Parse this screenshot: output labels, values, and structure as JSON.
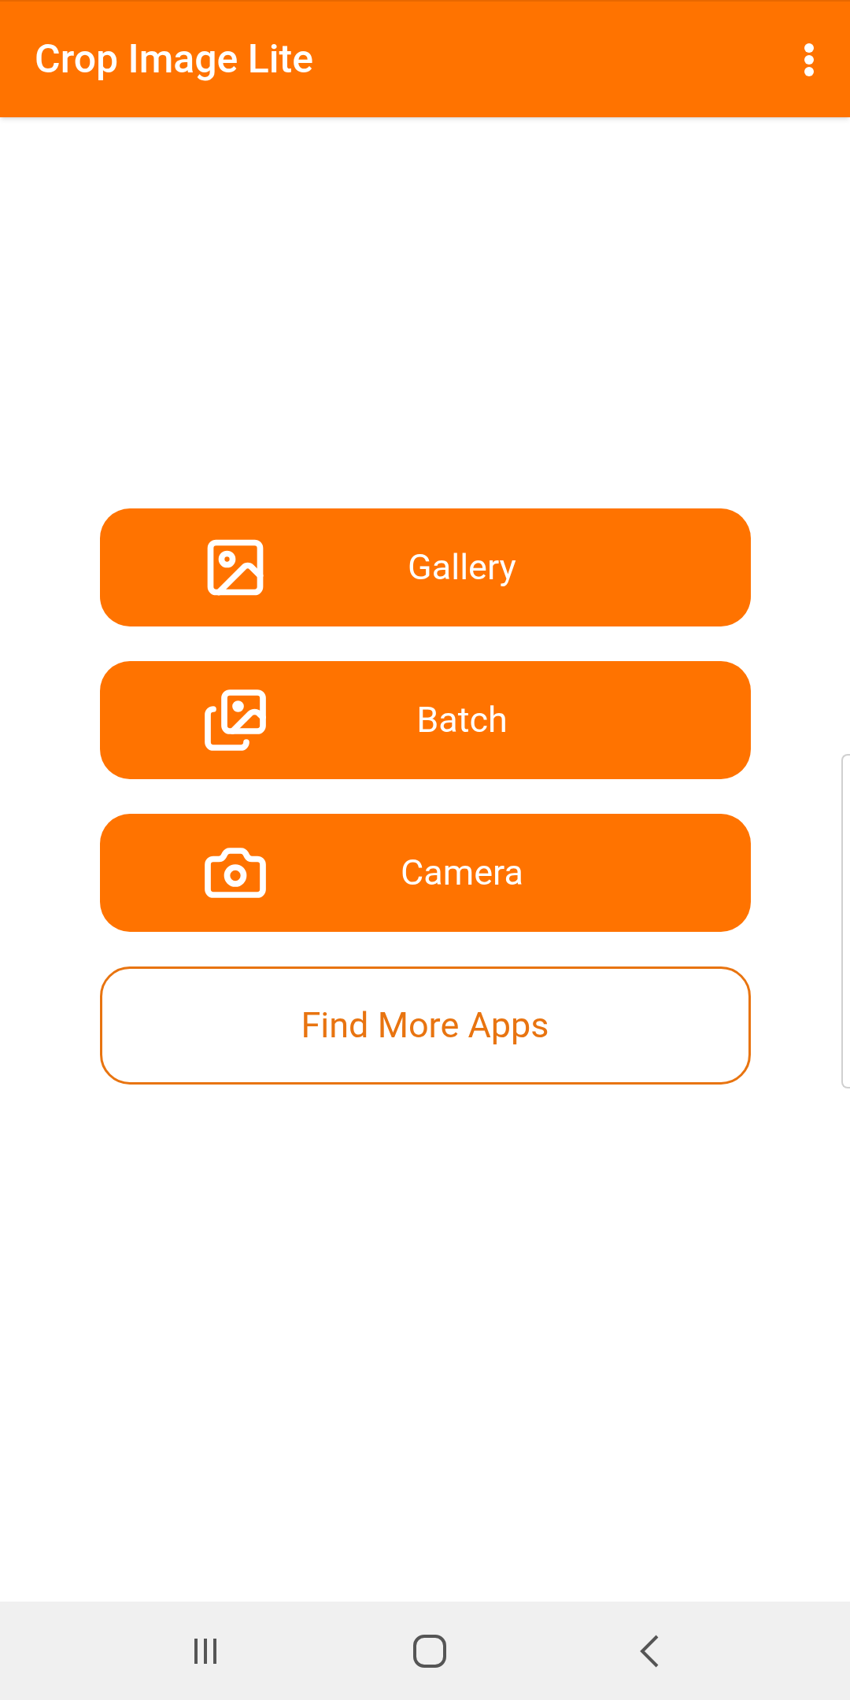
{
  "app_bar": {
    "title": "Crop Image Lite"
  },
  "buttons": [
    {
      "label": "Gallery",
      "kind": "filled"
    },
    {
      "label": "Batch",
      "kind": "filled"
    },
    {
      "label": "Camera",
      "kind": "filled"
    },
    {
      "label": "Find More Apps",
      "kind": "outlined"
    }
  ]
}
